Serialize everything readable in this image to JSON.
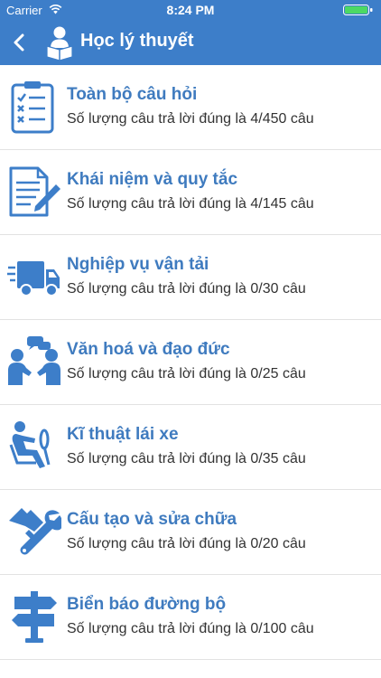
{
  "status": {
    "carrier": "Carrier",
    "time": "8:24 PM"
  },
  "header": {
    "title": "Học lý thuyết",
    "back_icon": "chevron-left-icon",
    "icon": "student-reading-icon"
  },
  "colors": {
    "header_bg": "#3d7ec9",
    "title": "#3f7bbf",
    "icon": "#3d7ec9"
  },
  "items": [
    {
      "title": "Toàn bộ câu hỏi",
      "subtitle": "Số lượng câu trả lời đúng là 4/450 câu",
      "icon": "checklist-clipboard-icon"
    },
    {
      "title": "Khái niệm và quy tắc",
      "subtitle": "Số lượng câu trả lời đúng là 4/145 câu",
      "icon": "document-pen-icon"
    },
    {
      "title": "Nghiệp vụ vận tải",
      "subtitle": "Số lượng câu trả lời đúng là 0/30 câu",
      "icon": "delivery-truck-icon"
    },
    {
      "title": "Văn hoá và đạo đức",
      "subtitle": "Số lượng câu trả lời đúng là 0/25 câu",
      "icon": "people-handshake-icon"
    },
    {
      "title": "Kĩ thuật lái xe",
      "subtitle": "Số lượng câu trả lời đúng là 0/35 câu",
      "icon": "driver-seat-icon"
    },
    {
      "title": "Cấu tạo và sửa chữa",
      "subtitle": "Số lượng câu trả lời đúng là 0/20 câu",
      "icon": "wrench-repair-icon"
    },
    {
      "title": "Biển báo đường bộ",
      "subtitle": "Số lượng câu trả lời đúng là 0/100 câu",
      "icon": "signpost-icon"
    }
  ]
}
